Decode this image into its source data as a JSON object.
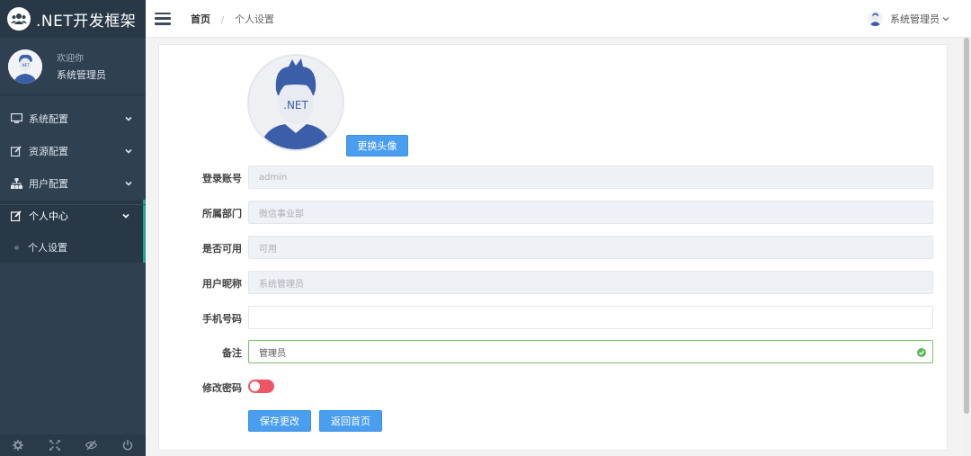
{
  "app": {
    "title": ".NET开发框架"
  },
  "sidebar": {
    "welcome": "欢迎你",
    "user_name": "系统管理员",
    "items": [
      {
        "label": "系统配置",
        "icon": "monitor-icon"
      },
      {
        "label": "资源配置",
        "icon": "edit-icon"
      },
      {
        "label": "用户配置",
        "icon": "sitemap-icon"
      },
      {
        "label": "个人中心",
        "icon": "edit-icon"
      }
    ],
    "sub_items": [
      {
        "label": "个人设置"
      }
    ],
    "footer_icons": [
      "gear-icon",
      "expand-icon",
      "eye-slash-icon",
      "power-icon"
    ]
  },
  "topbar": {
    "breadcrumb_home": "首页",
    "breadcrumb_sep": "/",
    "breadcrumb_current": "个人设置",
    "user_name": "系统管理员"
  },
  "form": {
    "avatar_text": ".NET",
    "change_avatar_label": "更换头像",
    "fields": [
      {
        "label": "登录账号",
        "value": "admin"
      },
      {
        "label": "所属部门",
        "value": "微信事业部"
      },
      {
        "label": "是否可用",
        "value": "可用"
      },
      {
        "label": "用户昵称",
        "value": "系统管理员"
      },
      {
        "label": "手机号码",
        "value": ""
      },
      {
        "label": "备注",
        "value": "管理员"
      }
    ],
    "change_password_label": "修改密码",
    "save_label": "保存更改",
    "back_label": "返回首页"
  },
  "colors": {
    "sidebar_bg": "#2f4050",
    "accent_green": "#19aa8d",
    "button_blue": "#4a9ef0",
    "toggle_red": "#ed5565",
    "valid_green": "#7cc36b"
  }
}
